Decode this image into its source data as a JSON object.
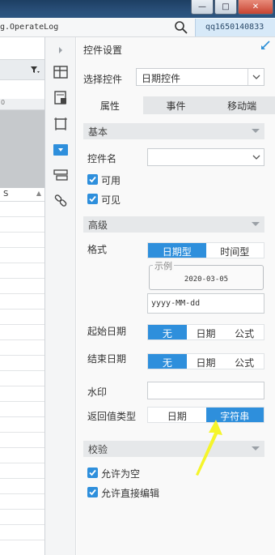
{
  "window": {
    "log_label": "g.OperateLog",
    "user": "qq1650140833",
    "min_glyph": "—",
    "max_glyph": "□",
    "close_glyph": "✕"
  },
  "left": {
    "ruler_label": "0",
    "column_header": "S"
  },
  "panel": {
    "title": "控件设置",
    "select_label": "选择控件",
    "select_value": "日期控件",
    "tabs": [
      "属性",
      "事件",
      "移动端"
    ],
    "basic": {
      "header": "基本",
      "name_label": "控件名",
      "name_value": "",
      "enabled_label": "可用",
      "visible_label": "可见"
    },
    "advanced": {
      "header": "高级",
      "format_label": "格式",
      "format_options": [
        "日期型",
        "时间型"
      ],
      "example_legend": "示例",
      "example_value": "2020-03-05",
      "pattern_value": "yyyy-MM-dd",
      "start_label": "起始日期",
      "start_options": [
        "无",
        "日期",
        "公式"
      ],
      "end_label": "结束日期",
      "end_options": [
        "无",
        "日期",
        "公式"
      ],
      "watermark_label": "水印",
      "watermark_value": "",
      "return_label": "返回值类型",
      "return_options": [
        "日期",
        "字符串"
      ]
    },
    "validation": {
      "header": "校验",
      "allow_empty_label": "允许为空",
      "allow_direct_edit_label": "允许直接编辑"
    }
  },
  "colors": {
    "accent": "#2e8fdc",
    "annotation": "#f5f52a"
  }
}
